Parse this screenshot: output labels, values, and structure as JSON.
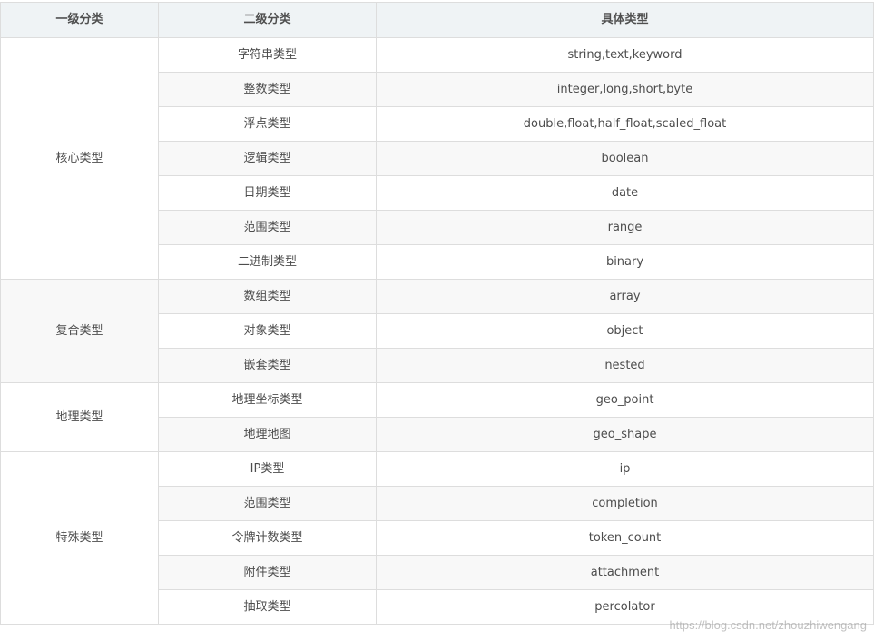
{
  "table": {
    "headers": [
      "一级分类",
      "二级分类",
      "具体类型"
    ],
    "groups": [
      {
        "label": "核心类型",
        "rows": [
          [
            "字符串类型",
            "string,text,keyword"
          ],
          [
            "整数类型",
            "integer,long,short,byte"
          ],
          [
            "浮点类型",
            "double,float,half_float,scaled_float"
          ],
          [
            "逻辑类型",
            "boolean"
          ],
          [
            "日期类型",
            "date"
          ],
          [
            "范围类型",
            "range"
          ],
          [
            "二进制类型",
            "binary"
          ]
        ]
      },
      {
        "label": "复合类型",
        "rows": [
          [
            "数组类型",
            "array"
          ],
          [
            "对象类型",
            "object"
          ],
          [
            "嵌套类型",
            "nested"
          ]
        ]
      },
      {
        "label": "地理类型",
        "rows": [
          [
            "地理坐标类型",
            "geo_point"
          ],
          [
            "地理地图",
            "geo_shape"
          ]
        ]
      },
      {
        "label": "特殊类型",
        "rows": [
          [
            "IP类型",
            "ip"
          ],
          [
            "范围类型",
            "completion"
          ],
          [
            "令牌计数类型",
            "token_count"
          ],
          [
            "附件类型",
            "attachment"
          ],
          [
            "抽取类型",
            "percolator"
          ]
        ]
      }
    ]
  },
  "watermark": "https://blog.csdn.net/zhouzhiwengang"
}
